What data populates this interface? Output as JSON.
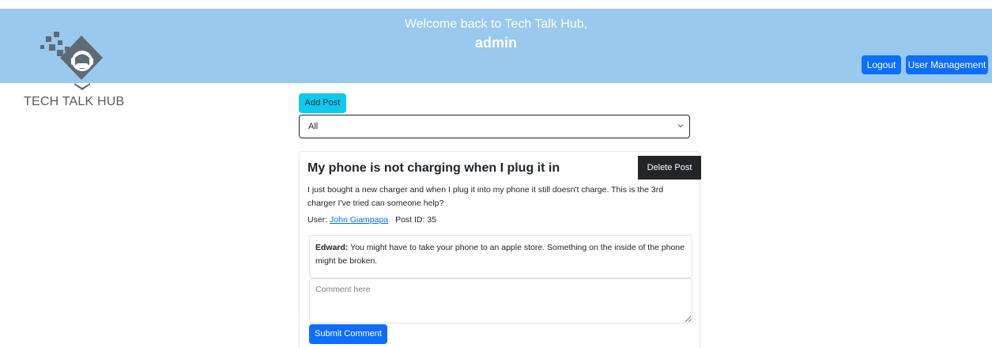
{
  "header": {
    "welcome": "Welcome back to Tech Talk Hub,",
    "username": "admin",
    "logout_label": "Logout",
    "user_management_label": "User Management",
    "background_color": "#99c9ee"
  },
  "logo": {
    "icon": "headphones-person-icon",
    "text": "TECH TALK HUB"
  },
  "toolbar": {
    "add_post_label": "Add Post",
    "filter_value": "All"
  },
  "post": {
    "title": "My phone is not charging when I plug it in",
    "delete_label": "Delete Post",
    "body": "I just bought a new charger and when I plug it into my phone it still doesn't charge. This is the 3rd charger I've tried can someone help?",
    "user_label": "User:",
    "user_name": "John Giampapa",
    "post_id_label": "Post ID:",
    "post_id": "35",
    "comments": [
      {
        "author": "Edward:",
        "text": "You might have to take your phone to an apple store. Something on the inside of the phone might be broken."
      }
    ],
    "comment_placeholder": "Comment here",
    "submit_label": "Submit Comment"
  },
  "colors": {
    "primary": "#0d6efd",
    "info": "#0dcaf0",
    "dark": "#212529"
  }
}
